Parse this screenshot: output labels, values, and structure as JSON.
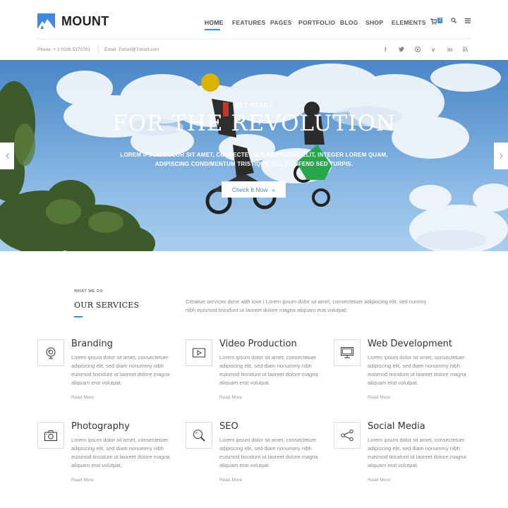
{
  "brand": {
    "name": "MOUNT",
    "accent": "#3f8ae0"
  },
  "nav": {
    "items": [
      "HOME",
      "FEATURES",
      "PAGES",
      "PORTFOLIO",
      "BLOG",
      "SHOP",
      "ELEMENTS"
    ],
    "active": "HOME",
    "cart_count": "2",
    "icons": [
      "cart-icon",
      "search-icon",
      "menu-icon"
    ]
  },
  "topbar": {
    "phone": "Phone: + 2 0106 5370701",
    "email": "Email: 7oroof@7oroof.com",
    "social": [
      "facebook-icon",
      "twitter-icon",
      "pinterest-icon",
      "vimeo-icon",
      "linkedin-icon",
      "rss-icon"
    ]
  },
  "hero": {
    "pre_title": "GET READY",
    "title": "FOR THE REVOLUTION",
    "subtitle": "LOREM IPSUM DOLOR SIT AMET, CONSECTETUER ADIPISCING ELIT, INTEGER LOREM QUAM, ADIPISCING CONDIMENTUM TRISTIQUE VEL, ELEIFEND SED TURPIS.",
    "button_label": "Check It Now",
    "button_arrow": "»"
  },
  "services": {
    "kicker": "WHAT WE DO",
    "heading": "OUR SERVICES",
    "intro": "Creative services done with love ! Lorem ipsum dolor sit amet, consectetuer adipiscing elit, sed nummy nibh euismod tincidunt ut laoreet dolore magna aliquam erat volutpat.",
    "items": [
      {
        "title": "Branding",
        "icon": "branding-icon",
        "text": "Lorem ipsum dolor sit amet, consectetuer adipiscing elit, sed diam nonummy nibh euismod tincidunt ut laoreet dolore magna aliquam erat volutpat.",
        "more": "Read More"
      },
      {
        "title": "Video Production",
        "icon": "video-icon",
        "text": "Lorem ipsum dolor sit amet, consectetuer adipiscing elit, sed diam nonummy nibh euismod tincidunt ut laoreet dolore magna aliquam erat volutpat.",
        "more": "Read More"
      },
      {
        "title": "Web Development",
        "icon": "monitor-icon",
        "text": "Lorem ipsum dolor sit amet, consectetuer adipiscing elit, sed diam nonummy nibh euismod tincidunt ut laoreet dolore magna aliquam erat volutpat.",
        "more": "Read More"
      },
      {
        "title": "Photography",
        "icon": "camera-icon",
        "text": "Lorem ipsum dolor sit amet, consectetuer adipiscing elit, sed diam nonummy nibh euismod tincidunt ut laoreet dolore magna aliquam erat volutpat.",
        "more": "Read More"
      },
      {
        "title": "SEO",
        "icon": "magnifier-icon",
        "text": "Lorem ipsum dolor sit amet, consectetuer adipiscing elit, sed diam nonummy nibh euismod tincidunt ut laoreet dolore magna aliquam erat volutpat.",
        "more": "Read More"
      },
      {
        "title": "Social Media",
        "icon": "share-icon",
        "text": "Lorem ipsum dolor sit amet, consectetuer adipiscing elit, sed diam nonummy nibh euismod tincidunt ut laoreet dolore magna aliquam erat volutpat.",
        "more": "Read More"
      }
    ]
  }
}
